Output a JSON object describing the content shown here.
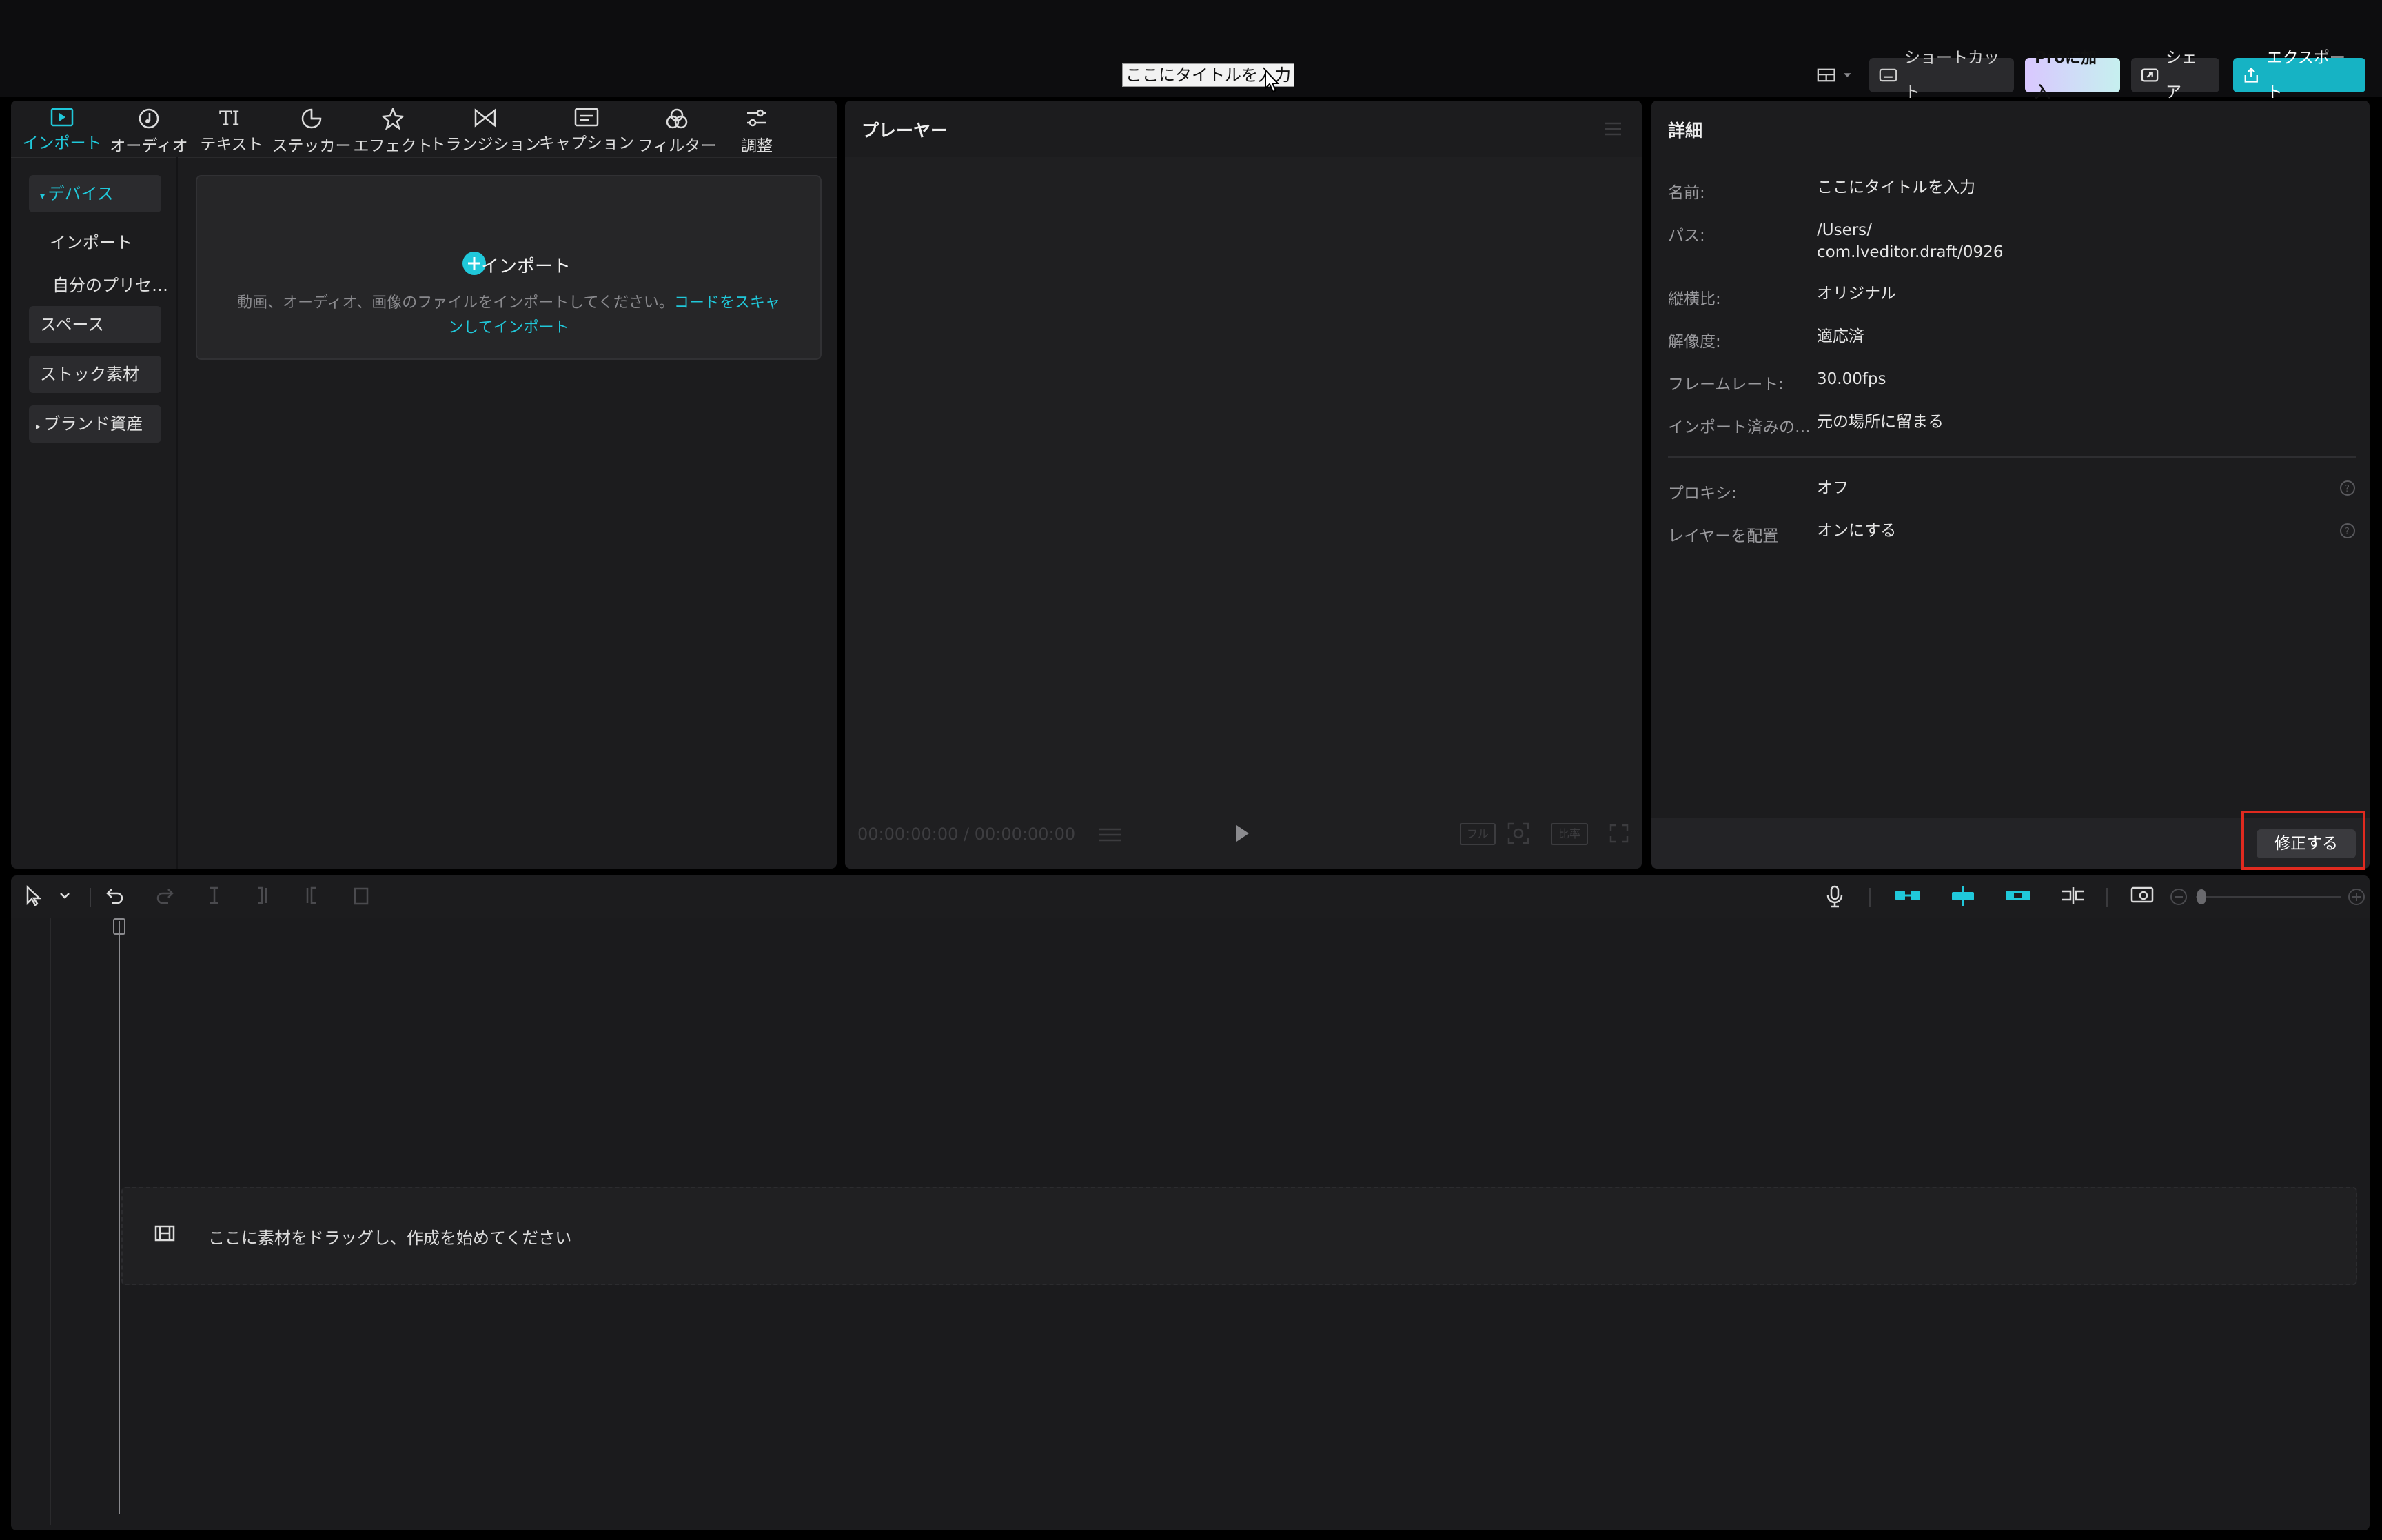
{
  "colors": {
    "accent": "#20c8da",
    "export": "#16b3c4",
    "highlight": "#e02a1f"
  },
  "topbar": {
    "title_input": "ここにタイトルを入力",
    "shortcut": "ショートカット",
    "pro": "Proに加入",
    "share": "シェア",
    "export": "エクスポート"
  },
  "media": {
    "tabs": [
      "インポート",
      "オーディオ",
      "テキスト",
      "ステッカー",
      "エフェクト",
      "トランジション",
      "キャプション",
      "フィルター",
      "調整"
    ],
    "sidebar": {
      "device": "デバイス",
      "import": "インポート",
      "presets": "自分のプリセ…",
      "space": "スペース",
      "stock": "ストック素材",
      "brand": "ブランド資産"
    },
    "import_box": {
      "title": "インポート",
      "desc": "動画、オーディオ、画像のファイルをインポートしてください。",
      "link": "コードをスキャンしてインポート"
    }
  },
  "player": {
    "title": "プレーヤー",
    "time": "00:00:00:00 / 00:00:00:00",
    "full_label": "フル",
    "ratio_label": "比率"
  },
  "details": {
    "title": "詳細",
    "rows": [
      {
        "label": "名前:",
        "value": "ここにタイトルを入力"
      },
      {
        "label": "パス:",
        "value": "/Users/",
        "value2": "com.lveditor.draft/0926"
      },
      {
        "label": "縦横比:",
        "value": "オリジナル"
      },
      {
        "label": "解像度:",
        "value": "適応済"
      },
      {
        "label": "フレームレート:",
        "value": "30.00fps"
      },
      {
        "label": "インポート済みの…",
        "value": "元の場所に留まる"
      },
      {
        "label": "プロキシ:",
        "value": "オフ"
      },
      {
        "label": "レイヤーを配置",
        "value": "オンにする"
      }
    ],
    "modify_button": "修正する"
  },
  "timeline": {
    "drop_text": "ここに素材をドラッグし、作成を始めてください"
  }
}
